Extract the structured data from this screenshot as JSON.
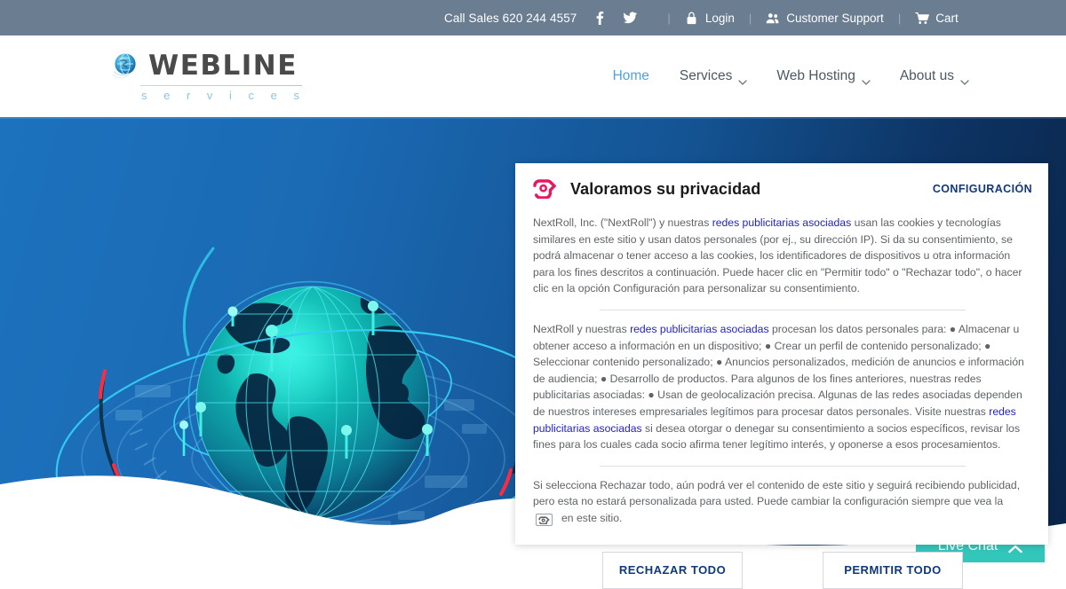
{
  "topbar": {
    "phone": "Call Sales 620 244 4557",
    "facebook_icon": "facebook-icon",
    "twitter_icon": "twitter-icon",
    "separator": "|",
    "login_label": "Login",
    "login_icon": "lock-icon",
    "support_label": "Customer Support",
    "support_icon": "users-icon",
    "cart_label": "Cart",
    "cart_icon": "shopping-cart-icon"
  },
  "header": {
    "logo": {
      "wordmark": "WEBLINE",
      "subtext": "s e r v i c e s",
      "icon": "globe-icon"
    },
    "nav": [
      {
        "label": "Home",
        "active": true,
        "caret": false
      },
      {
        "label": "Services",
        "active": false,
        "caret": true
      },
      {
        "label": "Web Hosting",
        "active": false,
        "caret": true
      },
      {
        "label": "About us",
        "active": false,
        "caret": true
      }
    ]
  },
  "hero": {
    "art": "globe-network-illustration",
    "bg_left_color": "#1c72bd",
    "bg_right_color": "#0a2347",
    "globe_color": "#0ec9c0"
  },
  "livechat": {
    "label": "Live Chat",
    "icon": "chevron-up-icon",
    "color": "#33c6bb"
  },
  "cookie": {
    "brand_icon": "nextroll-logo-icon",
    "title": "Valoramos su privacidad",
    "settings_label": "CONFIGURACIÓN",
    "link_color": "#2323c4",
    "p1": {
      "a": "NextRoll, Inc. (\"NextRoll\") y nuestras ",
      "link": "redes publicitarias asociadas",
      "b": " usan las cookies y tecnologías similares en este sitio y usan datos personales (por ej., su dirección IP). Si da su consentimiento, se podrá almacenar o tener acceso a las cookies, los identificadores de dispositivos u otra información para los fines descritos a continuación. Puede hacer clic en \"Permitir todo\" o \"Rechazar todo\", o hacer clic en la opción Configuración para personalizar su consentimiento."
    },
    "p2": {
      "a": "NextRoll y nuestras ",
      "link1": "redes publicitarias asociadas",
      "b": " procesan los datos personales para: ● Almacenar u obtener acceso a información en un dispositivo; ● Crear un perfil de contenido personalizado; ● Seleccionar contenido personalizado; ● Anuncios personalizados, medición de anuncios e información de audiencia; ● Desarrollo de productos. Para algunos de los fines anteriores, nuestras redes publicitarias asociadas: ● Usan de geolocalización precisa. Algunas de las redes asociadas dependen de nuestros intereses empresariales legítimos para procesar datos personales. Visite nuestras ",
      "link2": "redes publicitarias asociadas",
      "c": " si desea otorgar o denegar su consentimiento a socios específicos, revisar los fines para los cuales cada socio afirma tener legítimo interés, y oponerse a esos procesamientos."
    },
    "p3": {
      "a": "Si selecciona Rechazar todo, aún podrá ver el contenido de este sitio y seguirá recibiendo publicidad, pero esta no estará personalizada para usted. Puede cambiar la configuración siempre que vea la ",
      "icon": "nextroll-small-icon",
      "b": "en este sitio."
    },
    "reject_label": "RECHAZAR TODO",
    "accept_label": "PERMITIR TODO"
  }
}
